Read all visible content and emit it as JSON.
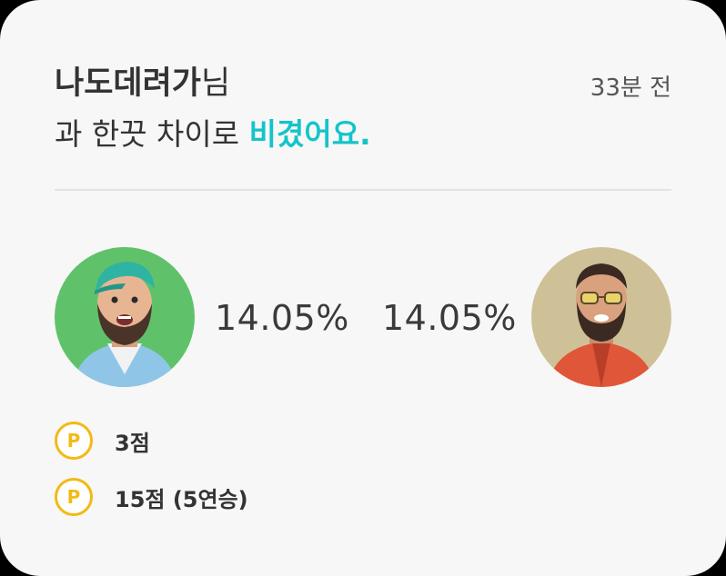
{
  "match": {
    "opponent_name": "나도데려가",
    "opponent_suffix": "님",
    "time_ago": "33분 전",
    "result_prefix": "과 한끗 차이로 ",
    "result_highlight": "비겼어요.",
    "highlight_color": "#14c4c9"
  },
  "players": {
    "left": {
      "percent": "14.05%",
      "avatar_icon": "avatar-cap-beard-icon"
    },
    "right": {
      "percent": "14.05%",
      "avatar_icon": "avatar-sunglasses-beard-icon"
    }
  },
  "points": [
    {
      "coin_label": "P",
      "text": "3점"
    },
    {
      "coin_label": "P",
      "text": "15점 (5연승)"
    }
  ],
  "colors": {
    "coin": "#f3b915",
    "left_avatar_bg": "#5fc26b",
    "right_avatar_bg": "#cfc197"
  }
}
